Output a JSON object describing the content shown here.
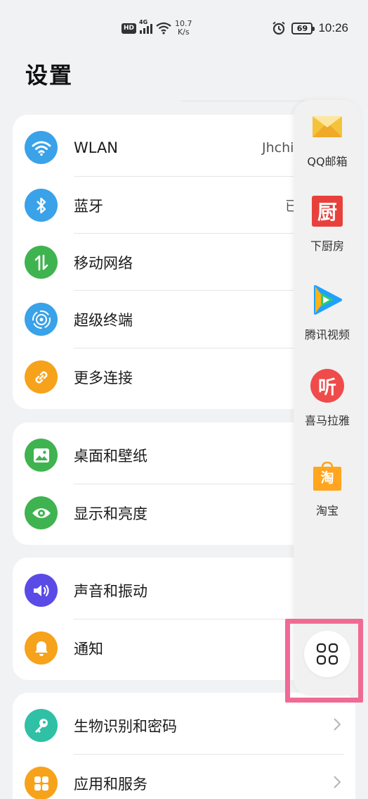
{
  "status_bar": {
    "hd": "HD",
    "network": "4G",
    "speed_value": "10.7",
    "speed_unit": "K/s",
    "battery": "69",
    "time": "10:26"
  },
  "page": {
    "title": "设置"
  },
  "groups": [
    {
      "items": [
        {
          "label": "WLAN",
          "value": "Jhchi",
          "icon": "wifi-icon",
          "color": "#3aa2e8"
        },
        {
          "label": "蓝牙",
          "value": "已",
          "icon": "bluetooth-icon",
          "color": "#3aa2e8"
        },
        {
          "label": "移动网络",
          "icon": "mobile-data-icon",
          "color": "#3fb34f"
        },
        {
          "label": "超级终端",
          "icon": "super-device-icon",
          "color": "#3aa2e8"
        },
        {
          "label": "更多连接",
          "icon": "link-icon",
          "color": "#f7a21b"
        }
      ]
    },
    {
      "items": [
        {
          "label": "桌面和壁纸",
          "icon": "wallpaper-icon",
          "color": "#3fb34f"
        },
        {
          "label": "显示和亮度",
          "icon": "eye-icon",
          "color": "#3fb34f"
        }
      ]
    },
    {
      "items": [
        {
          "label": "声音和振动",
          "icon": "speaker-icon",
          "color": "#5b4be6"
        },
        {
          "label": "通知",
          "icon": "bell-icon",
          "color": "#f7a21b"
        }
      ]
    },
    {
      "items": [
        {
          "label": "生物识别和密码",
          "icon": "key-icon",
          "color": "#2fc0a6"
        },
        {
          "label": "应用和服务",
          "icon": "apps-icon",
          "color": "#f7a21b"
        }
      ]
    }
  ],
  "dock": {
    "apps": [
      {
        "name": "QQ邮箱",
        "icon": "qq-mail-icon"
      },
      {
        "name": "下厨房",
        "icon": "xiachufang-icon",
        "glyph": "厨"
      },
      {
        "name": "腾讯视频",
        "icon": "tencent-video-icon"
      },
      {
        "name": "喜马拉雅",
        "icon": "ximalaya-icon",
        "glyph": "听"
      },
      {
        "name": "淘宝",
        "icon": "taobao-icon",
        "glyph": "淘"
      }
    ],
    "more_icon": "grid-icon"
  }
}
